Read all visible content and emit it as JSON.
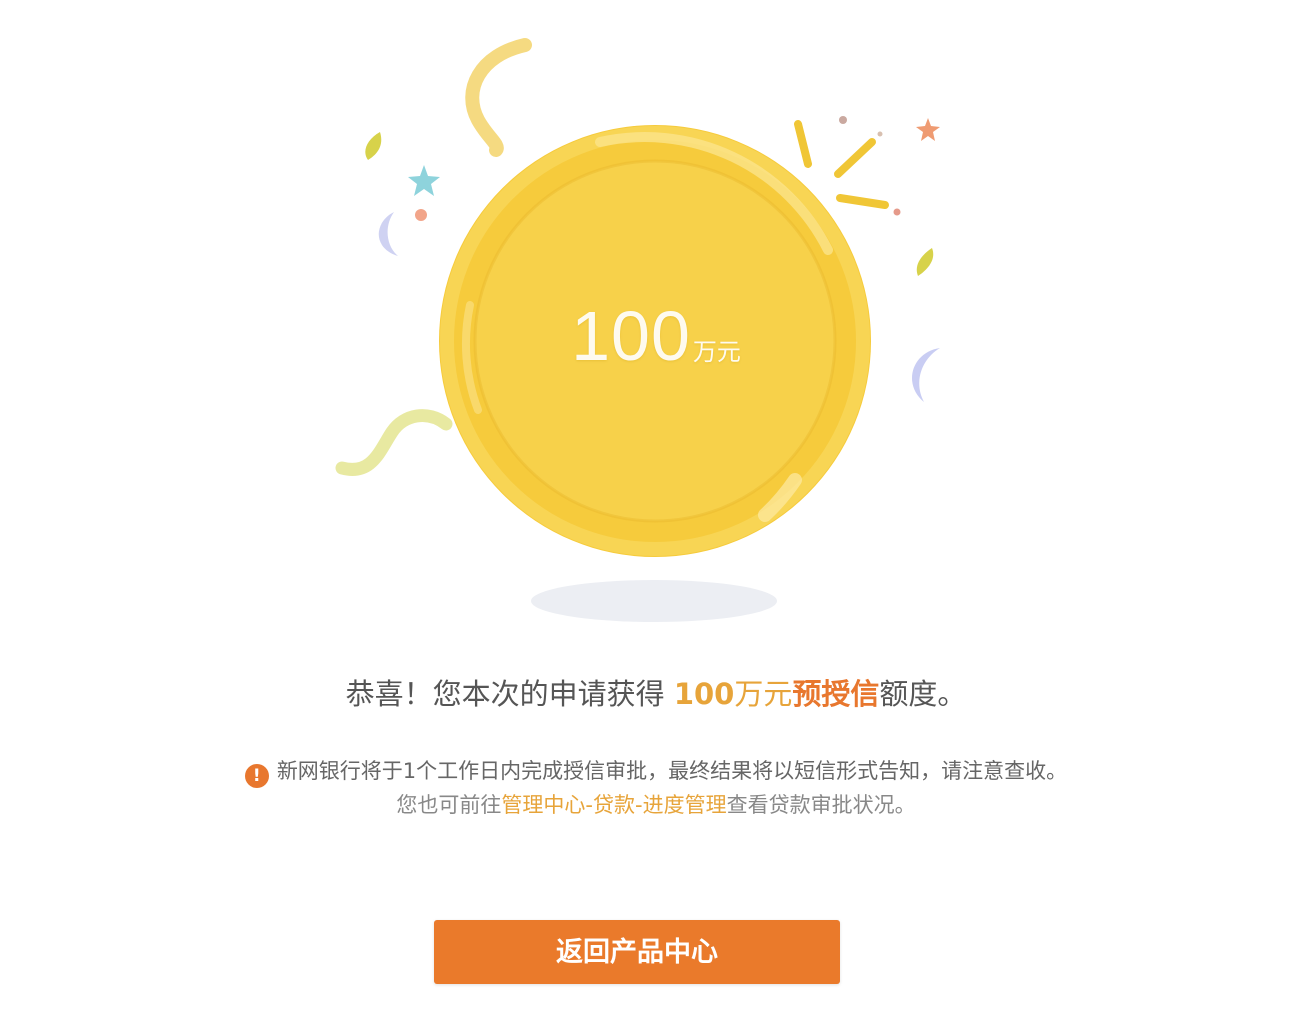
{
  "coin": {
    "amount": "100",
    "unit": "万元"
  },
  "headline": {
    "prefix": "恭喜！您本次的申请获得 ",
    "amount": "100",
    "unit": "万元",
    "tag": "预授信",
    "suffix": "额度。"
  },
  "notice": {
    "icon": "exclamation-icon",
    "line1": "新网银行将于1个工作日内完成授信审批，最终结果将以短信形式告知，请注意查收。",
    "line2_prefix": "您也可前往",
    "line2_link": "管理中心-贷款-进度管理",
    "line2_suffix": "查看贷款审批状况。"
  },
  "actions": {
    "back_label": "返回产品中心"
  },
  "colors": {
    "accent": "#ea7a2b",
    "gold": "#f6c93b",
    "highlight": "#e7a43a"
  }
}
